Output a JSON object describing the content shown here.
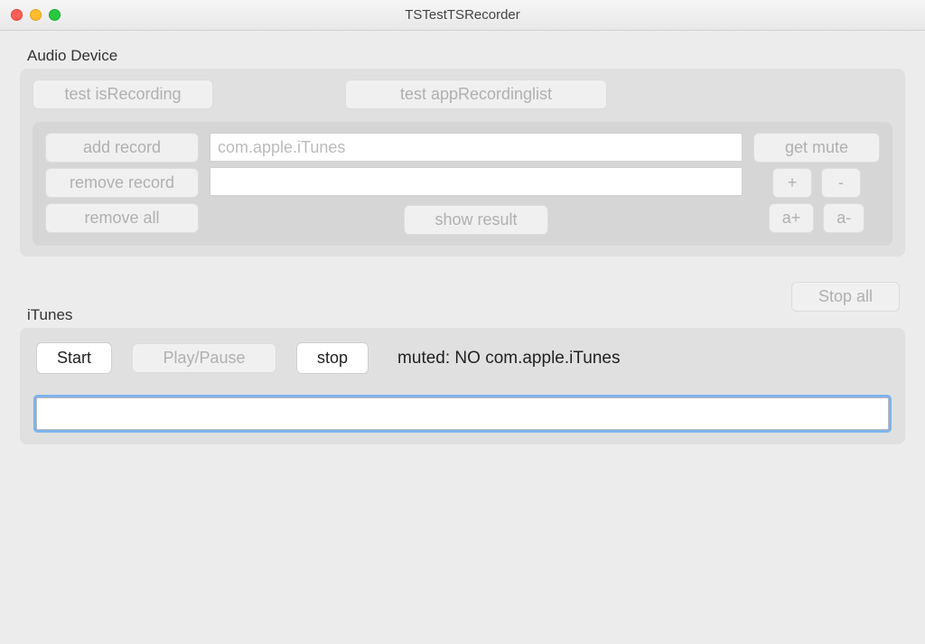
{
  "window": {
    "title": "TSTestTSRecorder"
  },
  "audio_device": {
    "label": "Audio Device",
    "test_is_recording": "test isRecording",
    "test_app_recording_list": "test appRecordinglist",
    "add_record": "add record",
    "remove_record": "remove record",
    "remove_all": "remove all",
    "input1_value": "com.apple.iTunes",
    "input2_value": "",
    "show_result": "show result",
    "get_mute": "get mute",
    "plus": "+",
    "minus": "-",
    "a_plus": "a+",
    "a_minus": "a-"
  },
  "stop_all": "Stop all",
  "itunes": {
    "label": "iTunes",
    "start": "Start",
    "play_pause": "Play/Pause",
    "stop": "stop",
    "status": "muted: NO  com.apple.iTunes",
    "main_input": ""
  }
}
